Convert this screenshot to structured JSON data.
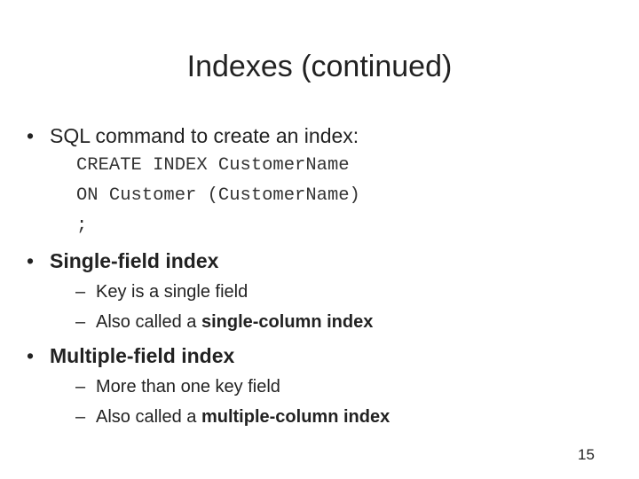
{
  "slide": {
    "title": "Indexes (continued)",
    "bullets": [
      {
        "text": "SQL command to create an index:",
        "code": [
          "CREATE INDEX CustomerName",
          "ON Customer (CustomerName)",
          ";"
        ]
      },
      {
        "text": "Single-field index",
        "subitems": [
          {
            "text": "Key is a single field"
          },
          {
            "prefix": "Also called a ",
            "bold": "single-column index"
          }
        ]
      },
      {
        "text": "Multiple-field index",
        "subitems": [
          {
            "text": "More than one key field"
          },
          {
            "prefix": "Also called a ",
            "bold": "multiple-column index"
          }
        ]
      }
    ],
    "bullet_glyph": "•",
    "dash_glyph": "–",
    "page_number": "15"
  }
}
